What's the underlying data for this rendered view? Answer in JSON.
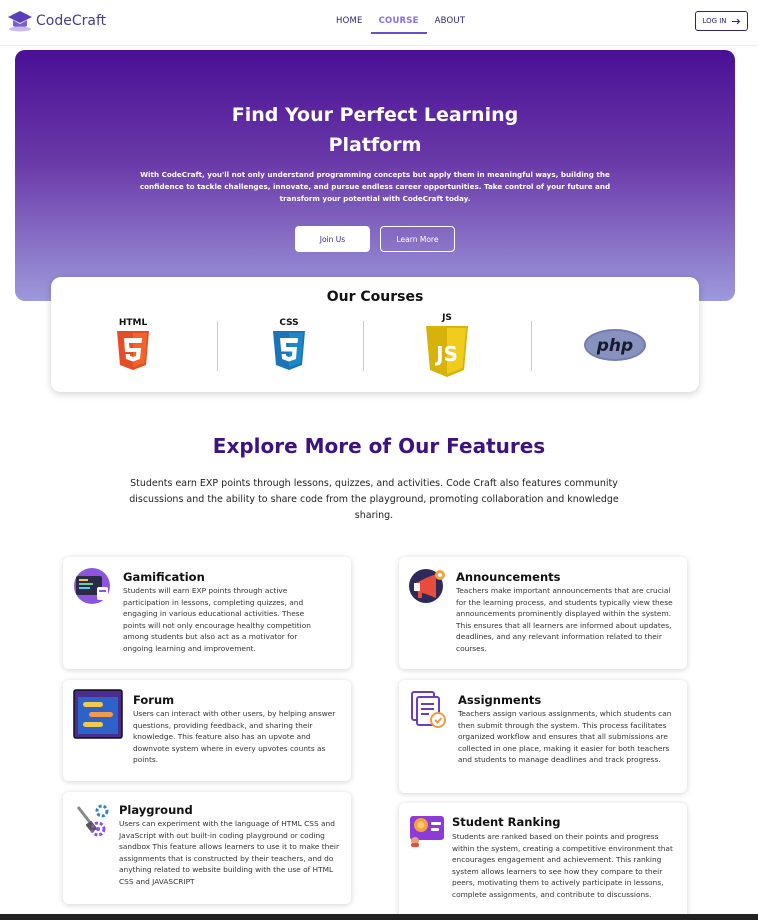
{
  "brand": {
    "name": "CodeCraft"
  },
  "nav": {
    "links": [
      "HOME",
      "COURSE",
      "ABOUT"
    ],
    "login_label": "LOG IN"
  },
  "hero": {
    "title_line1": "Find Your Perfect Learning",
    "title_line2": "Platform",
    "subtitle": "With CodeCraft, you'll not only understand programming concepts but apply them in meaningful ways, building the confidence to tackle challenges, innovate, and pursue endless career opportunities. Take control of your future and transform your potential with CodeCraft today.",
    "join_label": "Join Us",
    "learn_label": "Learn More"
  },
  "courses": {
    "title": "Our Courses",
    "items": [
      {
        "label": "HTML",
        "icon": "html5-icon"
      },
      {
        "label": "CSS",
        "icon": "css3-icon"
      },
      {
        "label": "JS",
        "icon": "javascript-icon"
      },
      {
        "label": "php",
        "icon": "php-icon"
      }
    ]
  },
  "features": {
    "title": "Explore More of Our Features",
    "description": "Students earn EXP points through lessons, quizzes, and activities. Code Craft also features community discussions and the ability to share code from the playground, promoting collaboration and knowledge sharing.",
    "cards": [
      {
        "title": "Gamification",
        "text": "Students will earn EXP points through active participation in lessons, completing quizzes, and engaging in various educational activities. These points will not only encourage healthy competition among students but also act as a motivator for ongoing learning and improvement.",
        "icon": "gamification-icon"
      },
      {
        "title": "Announcements",
        "text": "Teachers make important announcements that are crucial for the learning process, and students typically view these announcements prominently displayed within the system. This ensures that all learners are informed about updates, deadlines, and any relevant information related to their courses.",
        "icon": "megaphone-icon"
      },
      {
        "title": "Forum",
        "text": "Users can interact with other users, by helping answer questions, providing feedback, and sharing their knowledge. This feature also has an upvote and downvote system where in every upvotes counts as points.",
        "icon": "forum-icon"
      },
      {
        "title": "Assignments",
        "text": "Teachers assign various assignments, which students can then submit through the system. This process facilitates organized workflow and ensures that all submissions are collected in one place, making it easier for both teachers and students to manage deadlines and track progress.",
        "icon": "assignment-icon"
      },
      {
        "title": "Playground",
        "text": "Users can experiment with the language of HTML CSS and JavaScript with out built-in coding playground or coding sandbox This feature allows learners to use it to make their assignments that is constructed by their teachers, and do anything related to website building with the use of HTML CSS and JAVASCRIPT",
        "icon": "playground-icon"
      },
      {
        "title": "Student Ranking",
        "text": "Students are ranked based on their points and progress within the system, creating a competitive environment that encourages engagement and achievement. This ranking system allows learners to see how they compare to their peers, motivating them to actively participate in lessons, complete assignments, and contribute to discussions.",
        "icon": "ranking-icon"
      }
    ]
  }
}
